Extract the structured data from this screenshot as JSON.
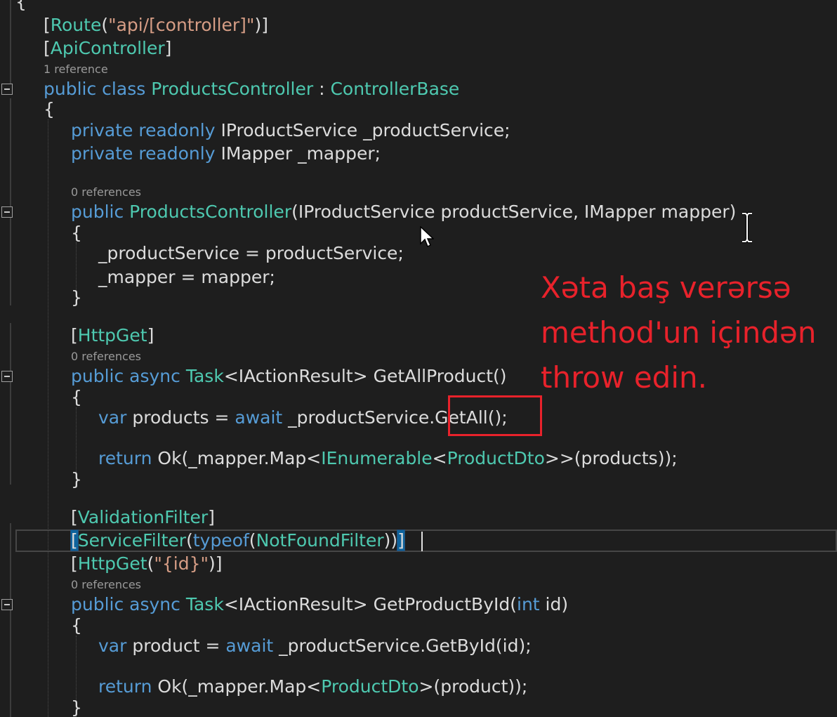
{
  "code": {
    "l0": "{",
    "route_open": "[",
    "route_type": "Route",
    "route_paren": "(",
    "route_str": "\"api/[controller]\"",
    "route_close": ")]",
    "api_open": "[",
    "api_type": "ApiController",
    "api_close": "]",
    "lens1": "1 reference",
    "cls_public": "public",
    "cls_class": " class ",
    "cls_name": "ProductsController",
    "cls_colon": " : ",
    "cls_base": "ControllerBase",
    "brace_open": "{",
    "f1_kw": "private readonly ",
    "f1_rest": "IProductService _productService;",
    "f2_kw": "private readonly ",
    "f2_rest": "IMapper _mapper;",
    "lens2": "0 references",
    "ctor_kw": "public ",
    "ctor_name": "ProductsController",
    "ctor_rest": "(IProductService productService, IMapper mapper)",
    "ctor_open": "{",
    "assign1": "_productService = productService;",
    "assign2": "_mapper = mapper;",
    "ctor_close": "}",
    "get_open": "[",
    "get_type": "HttpGet",
    "get_close": "]",
    "lens3": "0 references",
    "m1_kw": "public async ",
    "m1_task": "Task",
    "m1_rest": "<IActionResult> GetAllProduct()",
    "m1_open": "{",
    "m1_var": "var",
    "m1_mid": " products = ",
    "m1_await": "await",
    "m1_call": " _productService.GetAll();",
    "m1_return": "return",
    "m1_ok": " Ok(_mapper.Map<",
    "m1_ienum": "IEnumerable",
    "m1_lt": "<",
    "m1_dto": "ProductDto",
    "m1_end": ">>(products));",
    "m1_close": "}",
    "vf_open": "[",
    "vf_type": "ValidationFilter",
    "vf_close": "]",
    "sf_open": "[",
    "sf_type": "ServiceFilter",
    "sf_paren": "(",
    "sf_typeof": "typeof",
    "sf_paren2": "(",
    "sf_filter": "NotFoundFilter",
    "sf_close": "))",
    "sf_bracket": "]",
    "hg_open": "[",
    "hg_type": "HttpGet",
    "hg_paren": "(",
    "hg_str": "\"{id}\"",
    "hg_close": ")]",
    "lens4": "0 references",
    "m2_kw": "public async ",
    "m2_task": "Task",
    "m2_mid": "<IActionResult> GetProductById(",
    "m2_int": "int",
    "m2_end": " id)",
    "m2_open": "{",
    "m2_var": "var",
    "m2_mid2": " product = ",
    "m2_await": "await",
    "m2_call": " _productService.GetById(id);",
    "m2_return": "return",
    "m2_ok": " Ok(_mapper.Map<",
    "m2_dto": "ProductDto",
    "m2_end2": ">(product));",
    "m2_close": "}"
  },
  "annotation": {
    "line1": "Xəta baş verərsə",
    "line2": "method'un içindən",
    "line3": "throw edin."
  },
  "colors": {
    "keyword": "#569cd6",
    "type": "#4ec9b0",
    "string": "#d69d85",
    "text": "#dcdcdc",
    "annotation": "#e8222b"
  }
}
